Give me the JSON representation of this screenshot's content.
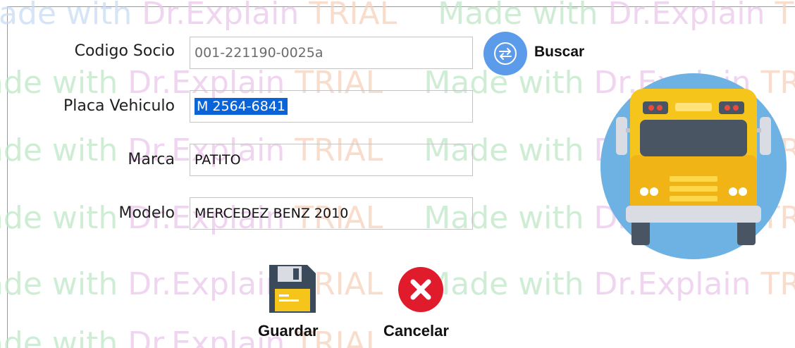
{
  "watermark": {
    "text_made": "Made with ",
    "text_dr": "Dr.Explain",
    "text_trial": " TRIAL"
  },
  "form": {
    "codigo_socio": {
      "label": "Codigo Socio",
      "value": "001-221190-0025a"
    },
    "placa_vehiculo": {
      "label": "Placa Vehiculo",
      "value": "M 2564-6841"
    },
    "marca": {
      "label": "Marca",
      "value": "PATITO"
    },
    "modelo": {
      "label": "Modelo",
      "value": "MERCEDEZ BENZ 2010"
    }
  },
  "search": {
    "label": "Buscar",
    "icon": "swap-arrows-icon"
  },
  "actions": {
    "save": {
      "label": "Guardar",
      "icon": "floppy-disk-icon"
    },
    "cancel": {
      "label": "Cancelar",
      "icon": "x-circle-icon"
    }
  },
  "illustration": {
    "icon": "school-bus-icon"
  },
  "colors": {
    "search_button": "#5b9bea",
    "selection": "#0a64d8",
    "bus_yellow": "#f6c51b",
    "bus_circle": "#6eb2e4",
    "cancel_red": "#e01b2c",
    "floppy_dark": "#3b4a5a"
  }
}
